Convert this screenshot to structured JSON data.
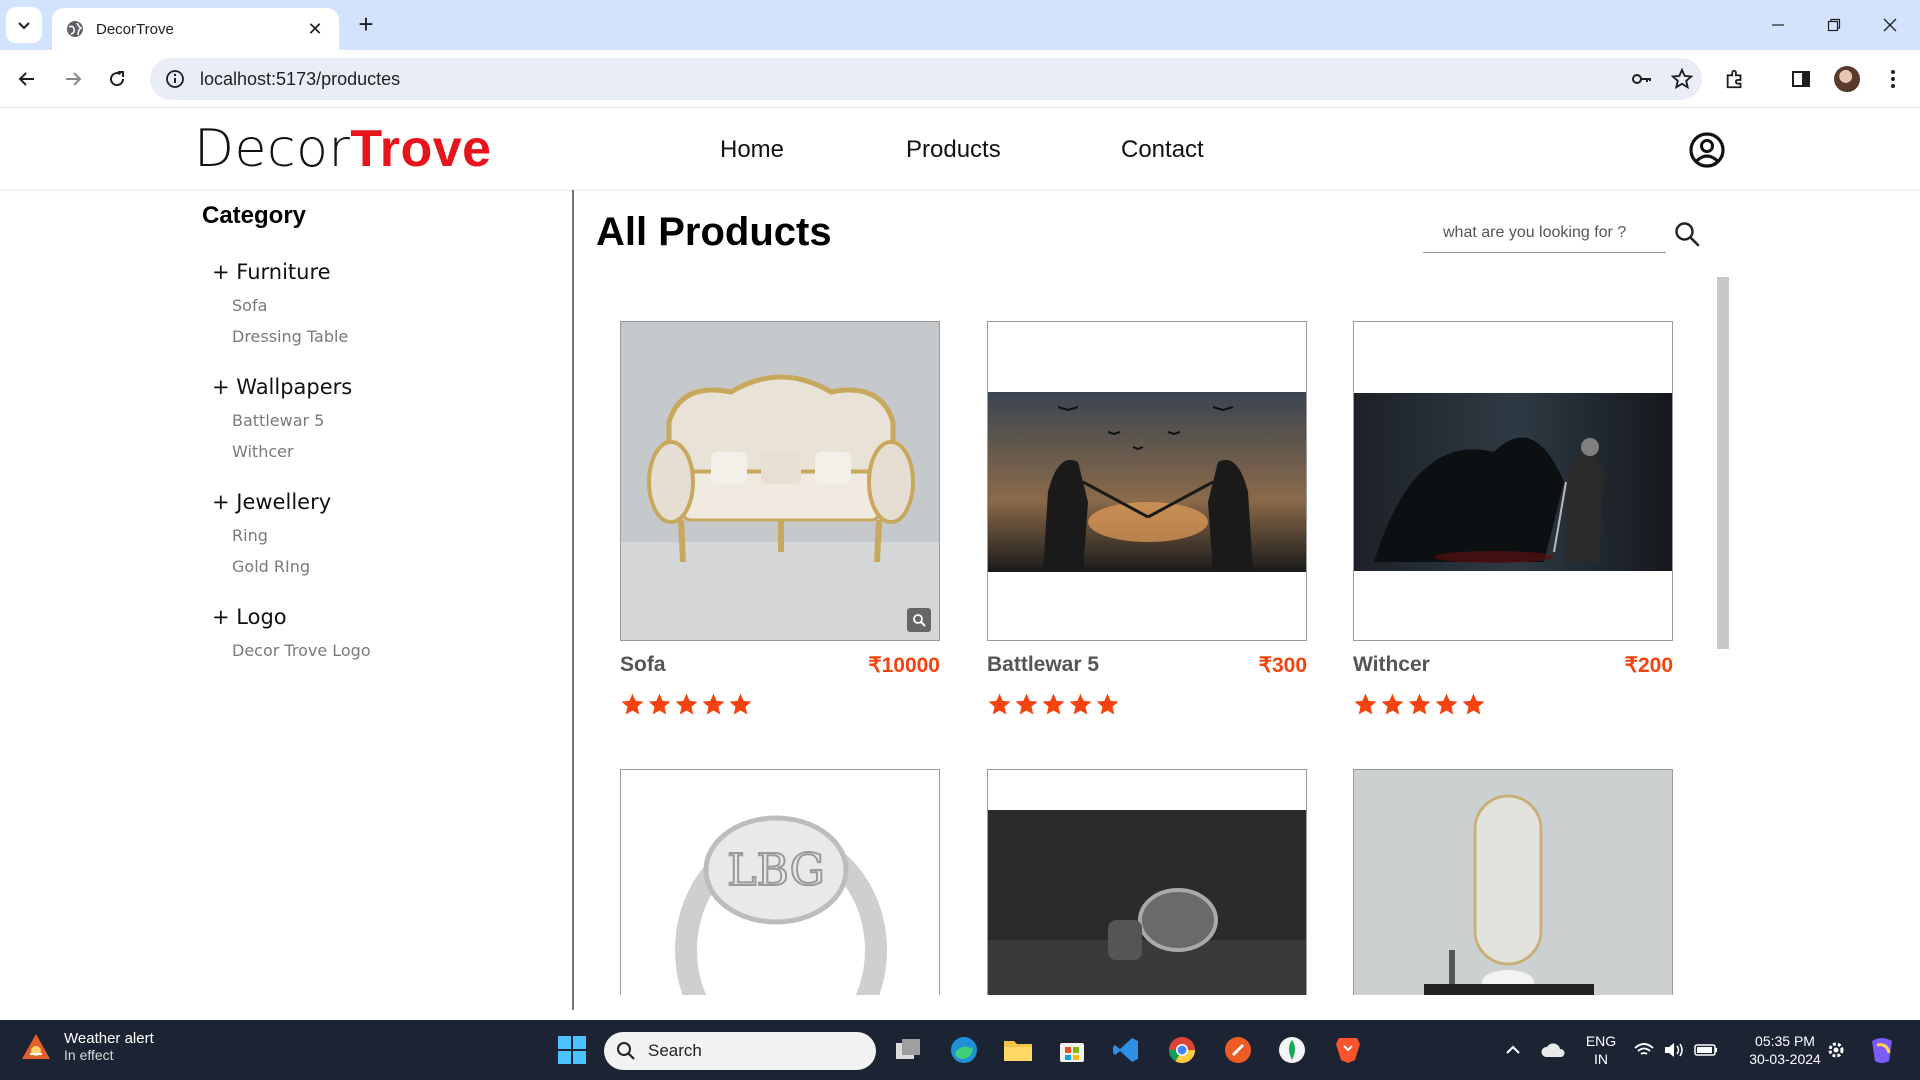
{
  "browser": {
    "tab_title": "DecorTrove",
    "url": "localhost:5173/productes"
  },
  "header": {
    "logo_part1": "Decor",
    "logo_part2": "Trove",
    "nav": [
      {
        "label": "Home"
      },
      {
        "label": "Products"
      },
      {
        "label": "Contact"
      }
    ]
  },
  "sidebar": {
    "heading": "Category",
    "groups": [
      {
        "title": "+ Furniture",
        "items": [
          "Sofa",
          "Dressing Table"
        ]
      },
      {
        "title": "+ Wallpapers",
        "items": [
          "Battlewar 5",
          "Withcer"
        ]
      },
      {
        "title": "+ Jewellery",
        "items": [
          "Ring",
          "Gold RIng"
        ]
      },
      {
        "title": "+ Logo",
        "items": [
          "Decor Trove Logo"
        ]
      }
    ]
  },
  "main": {
    "title": "All Products",
    "search_placeholder": "what are you looking for ?",
    "products": [
      {
        "name": "Sofa",
        "price": "₹10000",
        "rating": 5
      },
      {
        "name": "Battlewar 5",
        "price": "₹300",
        "rating": 5
      },
      {
        "name": "Withcer",
        "price": "₹200",
        "rating": 5
      },
      {
        "name": "",
        "price": "",
        "rating": 0
      },
      {
        "name": "",
        "price": "",
        "rating": 0
      },
      {
        "name": "",
        "price": "",
        "rating": 0
      }
    ],
    "star_color": "#f4430f"
  },
  "taskbar": {
    "weather_title": "Weather alert",
    "weather_sub": "In effect",
    "search_label": "Search",
    "lang_line1": "ENG",
    "lang_line2": "IN",
    "time": "05:35 PM",
    "date": "30-03-2024"
  }
}
